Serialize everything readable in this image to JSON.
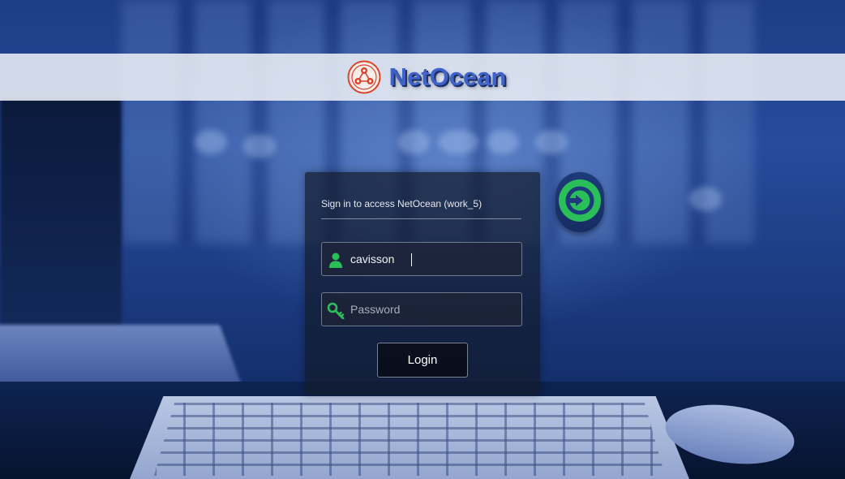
{
  "brand": {
    "name": "NetOcean",
    "logo_icon": "netocean-logo-icon"
  },
  "login": {
    "title": "Sign in to access NetOcean (work_5)",
    "username_value": "cavisson",
    "username_icon": "user-icon",
    "password_placeholder": "Password",
    "password_icon": "key-icon",
    "button_label": "Login"
  },
  "go_button": {
    "icon": "arrow-right-circle-icon"
  },
  "colors": {
    "brand_text": "#3f63c9",
    "accent_green": "#2bbf5a",
    "logo_red": "#d8452a"
  }
}
